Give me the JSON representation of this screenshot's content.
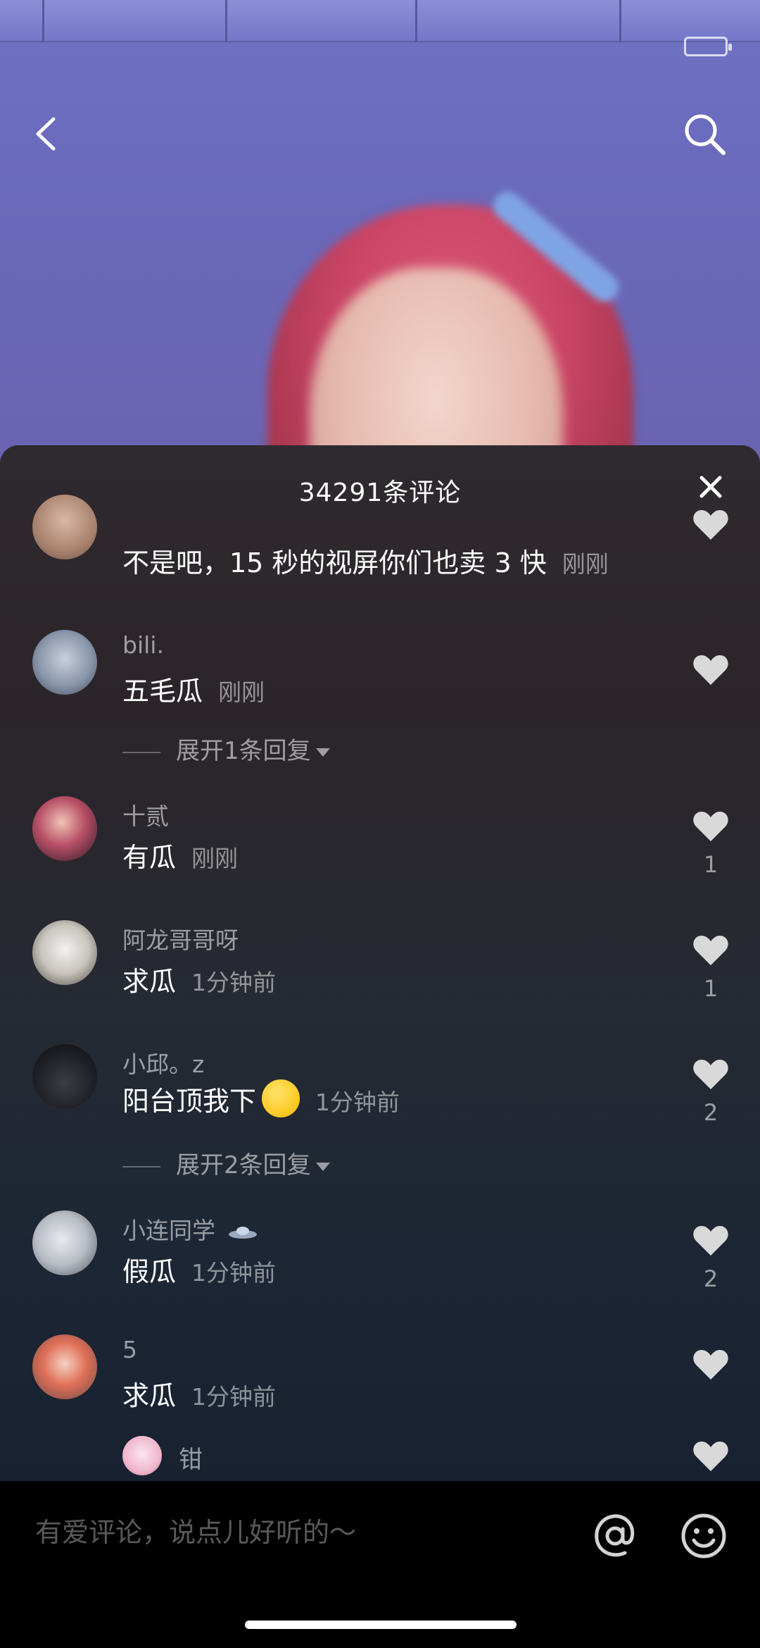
{
  "panel": {
    "title": "34291条评论"
  },
  "comments": [
    {
      "name": "",
      "text": "不是吧，15 秒的视屏你们也卖 3 快",
      "time": "刚刚",
      "likes": ""
    },
    {
      "name": "bili.",
      "text": "五毛瓜",
      "time": "刚刚",
      "likes": ""
    },
    {
      "name": "十贰",
      "text": "有瓜",
      "time": "刚刚",
      "likes": "1"
    },
    {
      "name": "阿龙哥哥呀",
      "text": "求瓜",
      "time": "1分钟前",
      "likes": "1"
    },
    {
      "name": "小邱。z",
      "text": "阳台顶我下",
      "time": "1分钟前",
      "likes": "2"
    },
    {
      "name": "小连同学",
      "text": "假瓜",
      "time": "1分钟前",
      "likes": "2"
    },
    {
      "name": "5",
      "text": "求瓜",
      "time": "1分钟前",
      "likes": ""
    }
  ],
  "expanders": [
    {
      "label": "展开1条回复"
    },
    {
      "label": "展开2条回复"
    }
  ],
  "reply_preview": {
    "name": "钳"
  },
  "input": {
    "placeholder": "有爱评论，说点儿好听的～"
  },
  "icons": {
    "back": "chevron-left-icon",
    "search": "search-icon",
    "close": "close-icon",
    "like": "heart-icon",
    "mention": "at-icon",
    "emoji": "smiley-icon",
    "expand": "caret-down-icon"
  },
  "colors": {
    "panel_bg_top": "#2f2a2f",
    "panel_bg_bottom": "#172130",
    "heart": "#d9d9d9"
  }
}
